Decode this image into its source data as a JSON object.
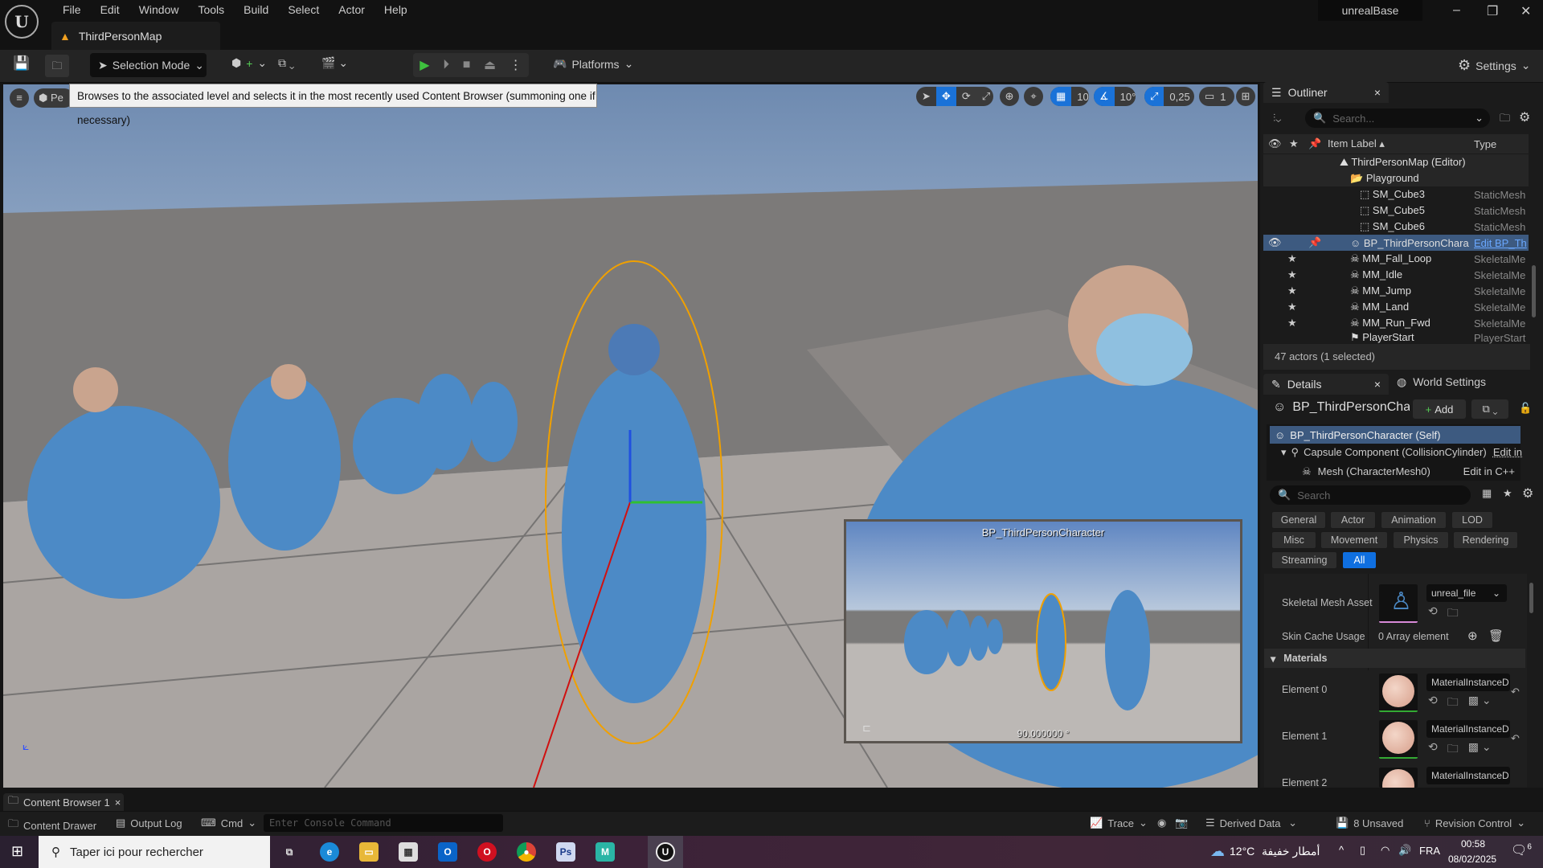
{
  "window": {
    "project_name": "unrealBase",
    "map_tab": "ThirdPersonMap"
  },
  "menu": [
    "File",
    "Edit",
    "Window",
    "Tools",
    "Build",
    "Select",
    "Actor",
    "Help"
  ],
  "toolbar": {
    "selection_mode": "Selection Mode",
    "platforms": "Platforms",
    "settings": "Settings"
  },
  "viewport": {
    "perspective_label": "Pe",
    "tooltip": "Browses to the associated level and selects it in the most recently used Content Browser (summoning one if necessary)",
    "grid_snap": "10",
    "rotation_snap": "10°",
    "scale_snap": "0,25",
    "camera_speed": "1",
    "preview_title": "BP_ThirdPersonCharacter",
    "preview_fov": "90.000000 °"
  },
  "outliner": {
    "tab": "Outliner",
    "search_placeholder": "Search...",
    "col_label": "Item Label",
    "col_type": "Type",
    "rows": [
      {
        "label": "ThirdPersonMap (Editor)",
        "type": ""
      },
      {
        "label": "Playground",
        "type": ""
      },
      {
        "label": "SM_Cube3",
        "type": "StaticMesh"
      },
      {
        "label": "SM_Cube5",
        "type": "StaticMesh"
      },
      {
        "label": "SM_Cube6",
        "type": "StaticMesh"
      },
      {
        "label": "BP_ThirdPersonChara",
        "type": "Edit BP_Th"
      },
      {
        "label": "MM_Fall_Loop",
        "type": "SkeletalMe"
      },
      {
        "label": "MM_Idle",
        "type": "SkeletalMe"
      },
      {
        "label": "MM_Jump",
        "type": "SkeletalMe"
      },
      {
        "label": "MM_Land",
        "type": "SkeletalMe"
      },
      {
        "label": "MM_Run_Fwd",
        "type": "SkeletalMe"
      },
      {
        "label": "PlayerStart",
        "type": "PlayerStart"
      }
    ],
    "footer": "47 actors (1 selected)"
  },
  "details": {
    "tab": "Details",
    "world_settings_tab": "World Settings",
    "object_name": "BP_ThirdPersonChara",
    "add_label": "Add",
    "components": [
      {
        "label": "BP_ThirdPersonCharacter (Self)",
        "action": ""
      },
      {
        "label": "Capsule Component (CollisionCylinder)",
        "action": "Edit in"
      },
      {
        "label": "Mesh (CharacterMesh0)",
        "action": "Edit in C++"
      }
    ],
    "search_placeholder": "Search",
    "filters": [
      "General",
      "Actor",
      "Animation",
      "LOD",
      "Misc",
      "Movement",
      "Physics",
      "Rendering",
      "Streaming",
      "All"
    ],
    "active_filter": "All",
    "skeletal_mesh_label": "Skeletal Mesh Asset",
    "skeletal_mesh_value": "unreal_file",
    "skin_cache_label": "Skin Cache Usage",
    "skin_cache_value": "0 Array element",
    "materials_section": "Materials",
    "materials": [
      {
        "label": "Element 0",
        "value": "MaterialInstanceD"
      },
      {
        "label": "Element 1",
        "value": "MaterialInstanceD"
      },
      {
        "label": "Element 2",
        "value": "MaterialInstanceD"
      }
    ]
  },
  "bottom": {
    "content_browser_tab": "Content Browser 1",
    "content_drawer": "Content Drawer",
    "output_log": "Output Log",
    "cmd": "Cmd",
    "console_placeholder": "Enter Console Command",
    "trace": "Trace",
    "derived_data": "Derived Data",
    "unsaved": "8 Unsaved",
    "revision_control": "Revision Control"
  },
  "taskbar": {
    "search_placeholder": "Taper ici pour rechercher",
    "weather_temp": "12°C",
    "weather_text": "أمطار خفيفة",
    "language": "FRA",
    "time": "00:58",
    "date": "08/02/2025",
    "notifications": "6"
  },
  "colors": {
    "accent": "#1a72d8",
    "selection": "#3d5a80",
    "selection_outline": "#f0a000"
  }
}
